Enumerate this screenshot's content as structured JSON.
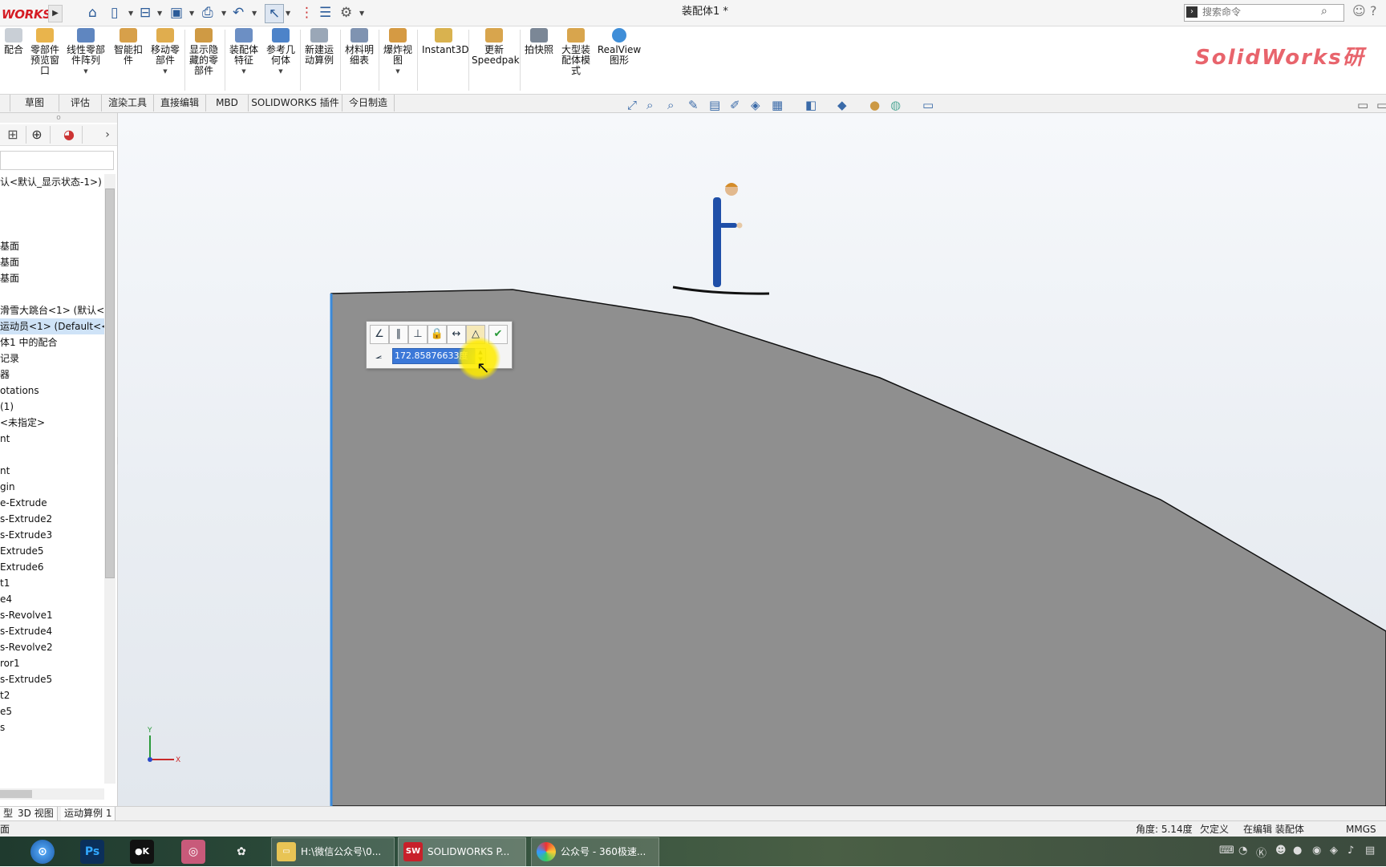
{
  "app": {
    "logo_text": "WORKS",
    "doc_title": "装配体1 *",
    "search_placeholder": "搜索命令"
  },
  "ribbon": {
    "buttons": [
      {
        "label": "配合",
        "icon": "mate-icon"
      },
      {
        "label": "零部件预览窗口",
        "icon": "component-preview-icon"
      },
      {
        "label": "线性零部件阵列",
        "icon": "linear-pattern-icon"
      },
      {
        "label": "智能扣件",
        "icon": "smart-fastener-icon"
      },
      {
        "label": "移动零部件",
        "icon": "move-component-icon"
      },
      {
        "label": "显示隐藏的零部件",
        "icon": "show-hidden-icon"
      },
      {
        "label": "装配体特征",
        "icon": "assembly-feature-icon"
      },
      {
        "label": "参考几何体",
        "icon": "reference-geometry-icon"
      },
      {
        "label": "新建运动算例",
        "icon": "motion-study-icon"
      },
      {
        "label": "材料明细表",
        "icon": "bom-icon"
      },
      {
        "label": "爆炸视图",
        "icon": "exploded-view-icon"
      },
      {
        "label": "Instant3D",
        "icon": "instant3d-icon"
      },
      {
        "label": "更新Speedpak",
        "icon": "speedpak-icon"
      },
      {
        "label": "拍快照",
        "icon": "snapshot-icon"
      },
      {
        "label": "大型装配体模式",
        "icon": "large-assembly-icon"
      },
      {
        "label": "RealView图形",
        "icon": "realview-icon"
      }
    ],
    "brand_watermark": "SolidWorks研"
  },
  "tabs": [
    "草图",
    "评估",
    "渲染工具",
    "直接编辑",
    "MBD",
    "SOLIDWORKS 插件",
    "今日制造"
  ],
  "tree": {
    "items": [
      {
        "label": "认<默认_显示状态-1>)",
        "selected": false
      },
      {
        "label": "",
        "selected": false
      },
      {
        "label": "",
        "selected": false
      },
      {
        "label": "",
        "selected": false
      },
      {
        "label": "基面",
        "selected": false
      },
      {
        "label": "基面",
        "selected": false
      },
      {
        "label": "基面",
        "selected": false
      },
      {
        "label": "",
        "selected": false
      },
      {
        "label": "滑雪大跳台<1> (默认<<",
        "selected": false
      },
      {
        "label": "运动员<1> (Default<<D",
        "selected": true
      },
      {
        "label": "体1 中的配合",
        "selected": false
      },
      {
        "label": "记录",
        "selected": false
      },
      {
        "label": "器",
        "selected": false
      },
      {
        "label": "otations",
        "selected": false
      },
      {
        "label": "(1)",
        "selected": false
      },
      {
        "label": "<未指定>",
        "selected": false
      },
      {
        "label": "nt",
        "selected": false
      },
      {
        "label": "",
        "selected": false
      },
      {
        "label": "nt",
        "selected": false
      },
      {
        "label": "gin",
        "selected": false
      },
      {
        "label": "e-Extrude",
        "selected": false
      },
      {
        "label": "s-Extrude2",
        "selected": false
      },
      {
        "label": "s-Extrude3",
        "selected": false
      },
      {
        "label": "Extrude5",
        "selected": false
      },
      {
        "label": "Extrude6",
        "selected": false
      },
      {
        "label": "t1",
        "selected": false
      },
      {
        "label": "e4",
        "selected": false
      },
      {
        "label": "s-Revolve1",
        "selected": false
      },
      {
        "label": "s-Extrude4",
        "selected": false
      },
      {
        "label": "s-Revolve2",
        "selected": false
      },
      {
        "label": "ror1",
        "selected": false
      },
      {
        "label": "s-Extrude5",
        "selected": false
      },
      {
        "label": "t2",
        "selected": false
      },
      {
        "label": "e5",
        "selected": false
      },
      {
        "label": "s",
        "selected": false
      }
    ]
  },
  "dimension_popup": {
    "value": "172.85876633度",
    "tools": [
      "angle-dim-icon",
      "parallel-icon",
      "perpendicular-icon",
      "lock-icon",
      "distance-icon",
      "angle-mate-icon",
      "check-icon"
    ]
  },
  "triad": {
    "x": "X",
    "y": "Y"
  },
  "bottom_tabs": [
    "型",
    "3D 视图",
    "运动算例 1"
  ],
  "status": {
    "left": "面",
    "angle": "角度: 5.14度",
    "defined": "欠定义",
    "mode": "在编辑 装配体",
    "units": "MMGS"
  },
  "taskbar": {
    "apps": [
      {
        "label": "H:\\微信公众号\\0...",
        "icon": "folder-icon"
      },
      {
        "label": "SOLIDWORKS P...",
        "icon": "solidworks-icon"
      },
      {
        "label": "公众号 - 360极速...",
        "icon": "browser-360-icon"
      }
    ],
    "pinned": [
      "windows-orb-icon",
      "browser-icon",
      "photoshop-icon",
      "ev-recorder-icon",
      "app-icon",
      "paint-icon"
    ]
  },
  "colors": {
    "ramp": "#8e8e8e",
    "selection": "#cfe3f7",
    "input_highlight": "#3b78d8",
    "cursor_halo": "#ffeb00",
    "accent_blue": "#2b5b99"
  }
}
